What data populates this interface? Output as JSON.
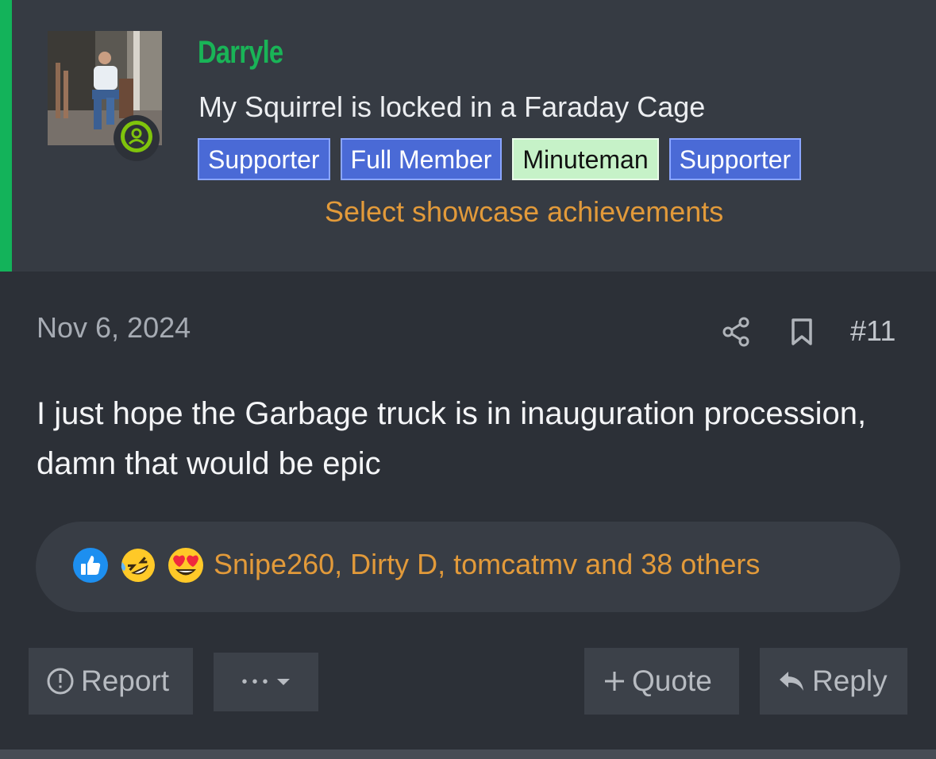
{
  "user": {
    "name": "Darryle",
    "title": "My Squirrel is locked in a Faraday Cage",
    "banners": [
      {
        "label": "Supporter",
        "style": "blue"
      },
      {
        "label": "Full Member",
        "style": "blue"
      },
      {
        "label": "Minuteman",
        "style": "green"
      },
      {
        "label": "Supporter",
        "style": "blue"
      }
    ],
    "showcase_link": "Select showcase achievements",
    "online_icon": "user-circle-icon"
  },
  "post": {
    "date": "Nov 6, 2024",
    "number": "#11",
    "body": "I just hope the Garbage truck is in inauguration procession, damn that would be epic"
  },
  "reactions": {
    "icons": [
      "like-icon",
      "rofl-emoji-icon",
      "heart-eyes-emoji-icon"
    ],
    "users_text": "Snipe260, Dirty D, tomcatmv and 38 others"
  },
  "actions": {
    "report": "Report",
    "more": "•••",
    "quote": "Quote",
    "reply": "Reply"
  },
  "colors": {
    "accent": "#13b35a",
    "link": "#e29a3a",
    "banner_blue": "#4a6ad6",
    "banner_green": "#c6f2c8"
  }
}
